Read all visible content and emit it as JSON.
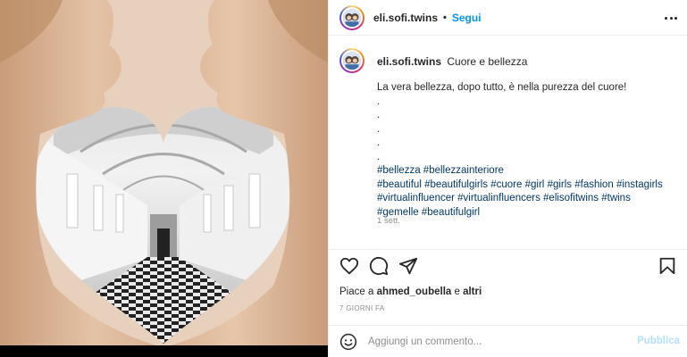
{
  "header": {
    "username": "eli.sofi.twins",
    "separator": "•",
    "follow_label": "Segui",
    "more_icon": "more-horizontal-icon"
  },
  "caption": {
    "username": "eli.sofi.twins",
    "title": "Cuore e bellezza",
    "text": "La vera bellezza, dopo tutto, è nella purezza del cuore!",
    "dots": [
      ".",
      ".",
      ".",
      ".",
      "."
    ],
    "hashtag_lines": [
      [
        "#bellezza",
        "#bellezzainteriore"
      ],
      [
        "#beautiful",
        "#beautifulgirls",
        "#cuore",
        "#girl",
        "#girls",
        "#fashion",
        "#instagirls"
      ],
      [
        "#virtualinfluencer",
        "#virtualinfluencers",
        "#elisofitwins",
        "#twins"
      ],
      [
        "#gemelle",
        "#beautifulgirl"
      ]
    ],
    "time_ago": "1 sett."
  },
  "actions": {
    "like_icon": "heart-icon",
    "comment_icon": "comment-icon",
    "share_icon": "share-icon",
    "save_icon": "bookmark-icon"
  },
  "likes": {
    "prefix": "Piace a",
    "user": "ahmed_oubella",
    "conjunction": "e",
    "others": "altri"
  },
  "date": "7 GIORNI FA",
  "comment": {
    "emoji_icon": "emoji-icon",
    "placeholder": "Aggiungi un commento...",
    "publish_label": "Pubblica"
  },
  "colors": {
    "link": "#0095f6",
    "hashtag": "#00376b",
    "muted": "#8e8e8e",
    "publish_disabled": "#b2dffc"
  }
}
